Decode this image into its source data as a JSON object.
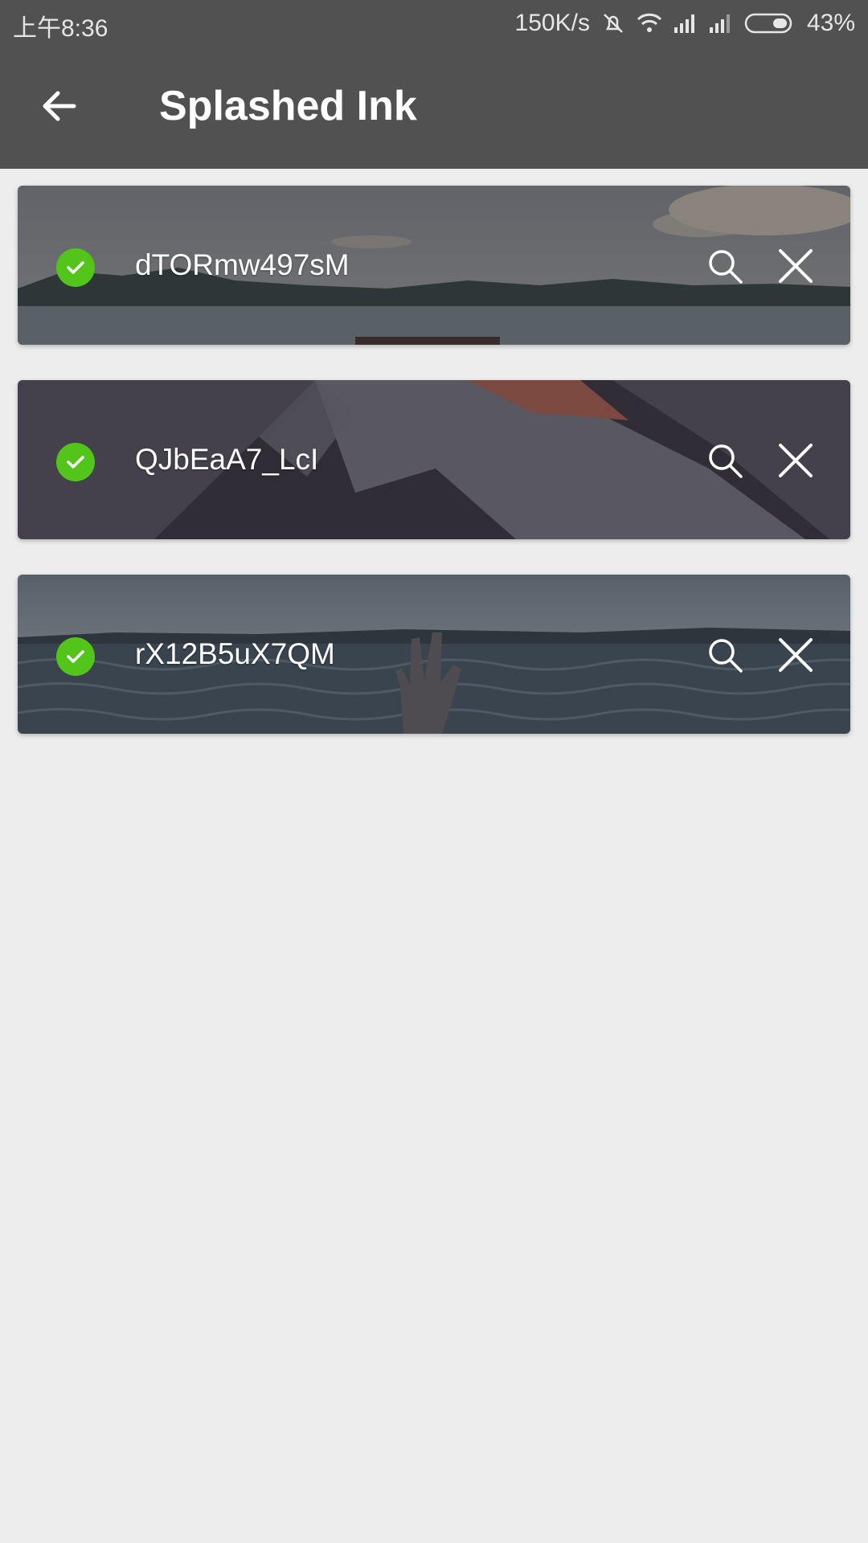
{
  "status_bar": {
    "time": "上午8:36",
    "network_speed": "150K/s",
    "battery_percent": "43%",
    "icons": [
      "mute-icon",
      "wifi-icon",
      "signal-icon",
      "signal-icon",
      "battery-icon"
    ]
  },
  "app_bar": {
    "title": "Splashed Ink",
    "back_icon": "arrow-left-icon"
  },
  "items": [
    {
      "id": "dTORmw497sM",
      "status_icon": "check-circle-icon",
      "scene": "sea-horizon-with-pier"
    },
    {
      "id": "QJbEaA7_LcI",
      "status_icon": "check-circle-icon",
      "scene": "snowy-mountain-peak"
    },
    {
      "id": "rX12B5uX7QM",
      "status_icon": "check-circle-icon",
      "scene": "hand-rising-from-water"
    }
  ],
  "colors": {
    "bar": "#515151",
    "background": "#ededee",
    "success": "#52c41a"
  }
}
